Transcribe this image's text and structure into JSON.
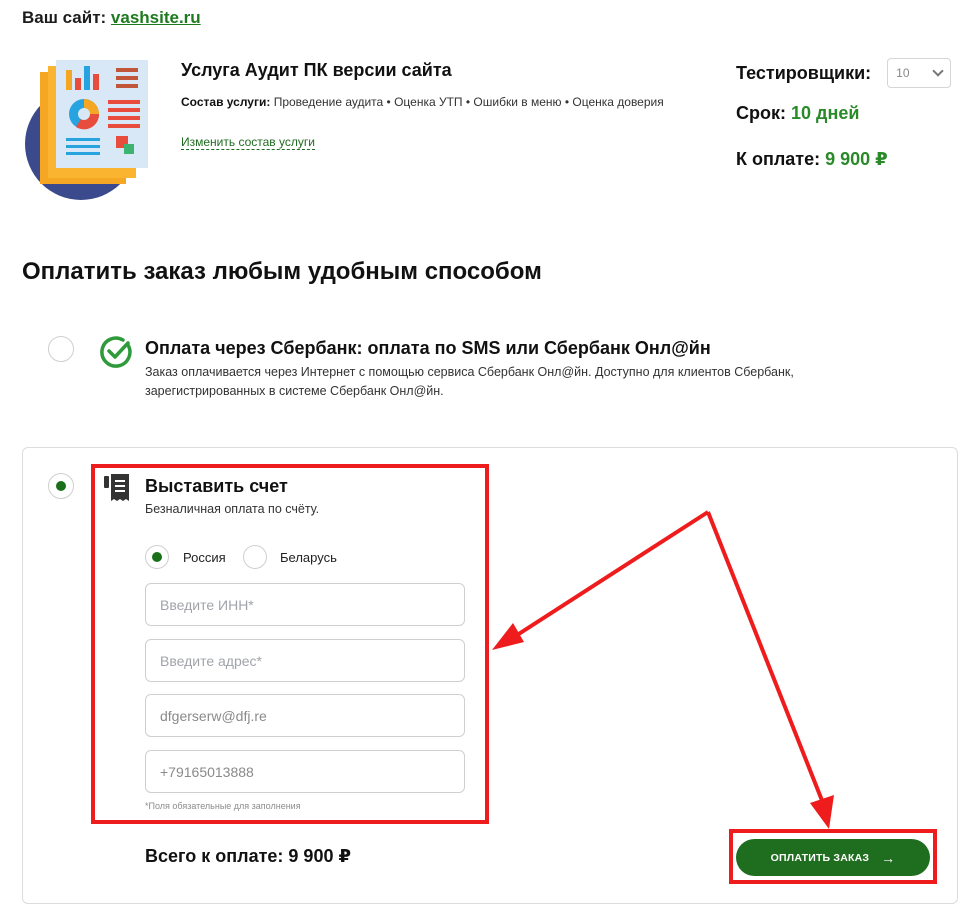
{
  "site": {
    "label": "Ваш сайт:",
    "link": "vashsite.ru"
  },
  "service": {
    "title": "Услуга Аудит ПК версии сайта",
    "composition_label": "Состав услуги:",
    "composition_text": "Проведение аудита • Оценка УТП • Ошибки в меню • Оценка доверия",
    "change_link": "Изменить состав услуги"
  },
  "summary": {
    "testers_label": "Тестировщики:",
    "testers_value": "10",
    "term_label": "Срок:",
    "term_value": "10 дней",
    "price_label": "К оплате:",
    "price_value": "9 900 ₽"
  },
  "payment": {
    "title": "Оплатить заказ любым удобным способом",
    "sber": {
      "title": "Оплата через Сбербанк: оплата по SMS или Сбербанк Онл@йн",
      "desc_line1": "Заказ оплачивается через Интернет с помощью сервиса Сбербанк Онл@йн. Доступно для клиентов Сбербанк,",
      "desc_line2": "зарегистрированных в системе Сбербанк Онл@йн.",
      "icon": "check-circle-icon"
    },
    "invoice": {
      "title": "Выставить счет",
      "desc": "Безналичная оплата по счёту.",
      "icon": "receipt-icon",
      "countries": [
        "Россия",
        "Беларусь"
      ],
      "selected_country": "Россия",
      "inn_placeholder": "Введите ИНН*",
      "address_placeholder": "Введите адрес*",
      "email_value": "dfgerserw@dfj.re",
      "phone_value": "+79165013888",
      "required_note": "*Поля обязательные для заполнения",
      "total": "Всего к оплате: 9 900 ₽",
      "button": "ОПЛАТИТЬ ЗАКАЗ",
      "button_arrow": "→"
    }
  },
  "colors": {
    "brand_green": "#1f6d1f",
    "accent_green": "#2a8a2a",
    "highlight_red": "#ee1c1c"
  }
}
